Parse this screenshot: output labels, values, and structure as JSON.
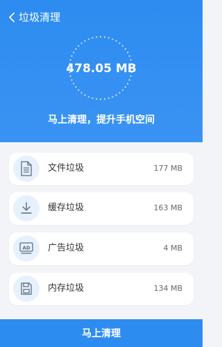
{
  "header": {
    "title": "垃圾清理",
    "total_size": "478.05 MB",
    "tagline": "马上清理，提升手机空间"
  },
  "items": [
    {
      "label": "文件垃圾",
      "size": "177 MB",
      "icon": "file-icon"
    },
    {
      "label": "缓存垃圾",
      "size": "163 MB",
      "icon": "download-icon"
    },
    {
      "label": "广告垃圾",
      "size": "4 MB",
      "icon": "ad-icon"
    },
    {
      "label": "内存垃圾",
      "size": "134 MB",
      "icon": "memory-card-icon"
    }
  ],
  "action": {
    "clean_label": "马上清理"
  },
  "colors": {
    "primary": "#2d8cf0",
    "icon_bg": "#e7f1fd",
    "page_bg": "#f2f4f7"
  }
}
